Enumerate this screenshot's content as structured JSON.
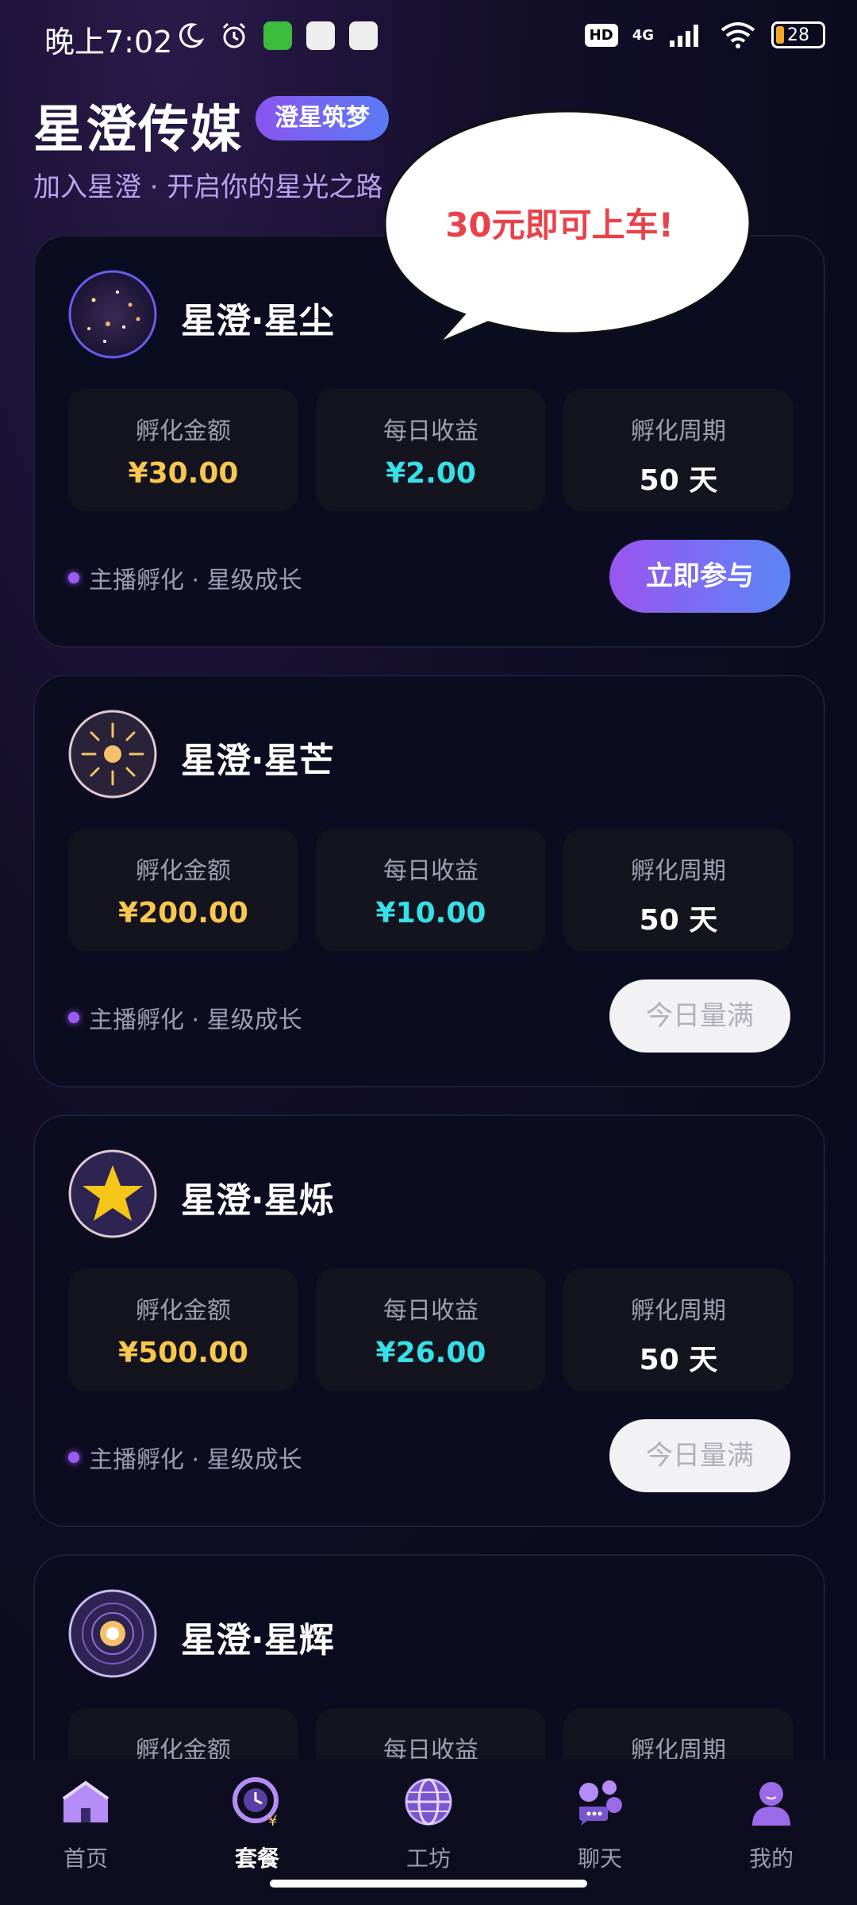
{
  "status_bar": {
    "time": "晚上7:02",
    "network": "4G",
    "hd": "HD",
    "battery": "28"
  },
  "header": {
    "title": "星澄传媒",
    "tag": "澄星筑梦",
    "subtitle": "加入星澄 · 开启你的星光之路"
  },
  "bubble": {
    "text": "30元即可上车!"
  },
  "labels": {
    "amount": "孵化金额",
    "daily": "每日收益",
    "cycle": "孵化周期",
    "footer": "主播孵化 · 星级成长"
  },
  "packages": [
    {
      "name": "星澄·星尘",
      "amount": "¥30.00",
      "daily": "¥2.00",
      "cycle": "50 天",
      "button": "立即参与"
    },
    {
      "name": "星澄·星芒",
      "amount": "¥200.00",
      "daily": "¥10.00",
      "cycle": "50 天",
      "button": "今日量满"
    },
    {
      "name": "星澄·星烁",
      "amount": "¥500.00",
      "daily": "¥26.00",
      "cycle": "50 天",
      "button": "今日量满"
    },
    {
      "name": "星澄·星辉"
    }
  ],
  "nav": [
    {
      "label": "首页",
      "icon": "home-icon"
    },
    {
      "label": "套餐",
      "icon": "package-icon"
    },
    {
      "label": "工坊",
      "icon": "globe-icon"
    },
    {
      "label": "聊天",
      "icon": "chat-icon"
    },
    {
      "label": "我的",
      "icon": "profile-icon"
    }
  ],
  "colors": {
    "accent_purple": "#9a55ee",
    "accent_blue": "#5b86f6",
    "amount_yellow": "#f9c74f",
    "daily_cyan": "#36e0e6",
    "bubble_text_red": "#e8424a"
  }
}
